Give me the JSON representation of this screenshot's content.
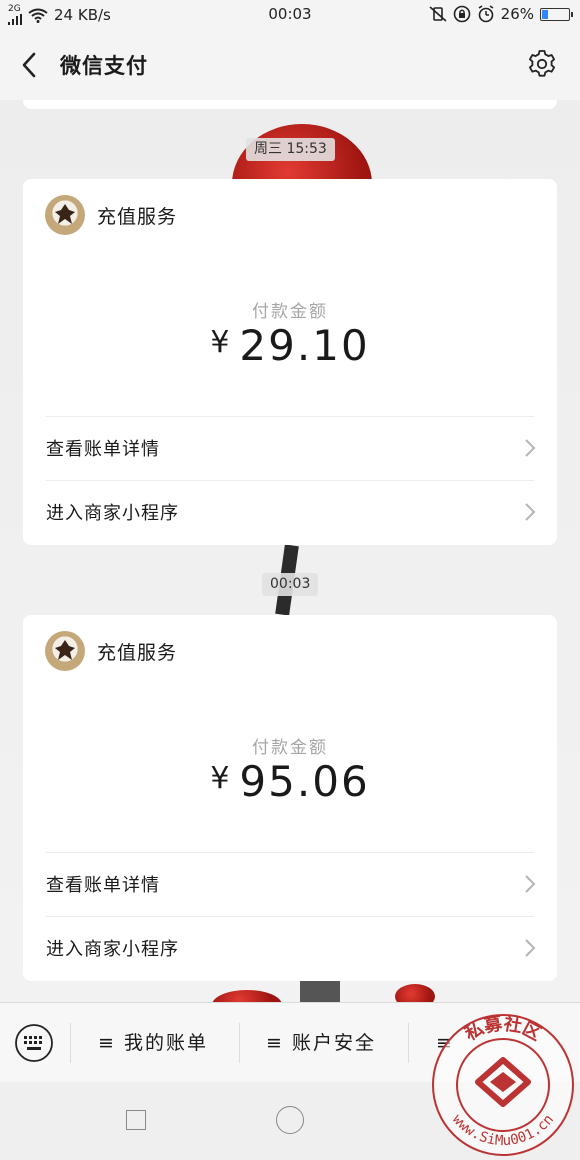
{
  "status_bar": {
    "network": "2G",
    "speed": "24 KB/s",
    "time": "00:03",
    "battery": "26%",
    "battery_level": 0.26
  },
  "nav": {
    "title": "微信支付"
  },
  "messages": [
    {
      "timestamp": "周三 15:53",
      "service": "充值服务",
      "amount_label": "付款金额",
      "currency": "¥",
      "amount": "29.10",
      "actions": [
        "查看账单详情",
        "进入商家小程序"
      ]
    },
    {
      "timestamp": "00:03",
      "service": "充值服务",
      "amount_label": "付款金额",
      "currency": "¥",
      "amount": "95.06",
      "actions": [
        "查看账单详情",
        "进入商家小程序"
      ]
    }
  ],
  "menu": {
    "items": [
      "≡ 我的账单",
      "≡ 账户安全",
      "≡"
    ]
  },
  "watermark": {
    "text": "www.SiMu001.cn",
    "seal_text": "私募社区"
  },
  "colors": {
    "accent_red": "#c0392b",
    "battery_blue": "#2f86ff"
  }
}
